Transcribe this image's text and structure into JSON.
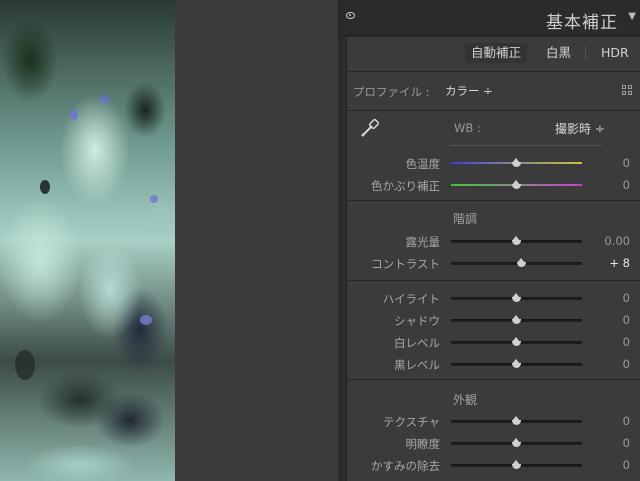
{
  "panel": {
    "title": "基本補正",
    "treatment_buttons": {
      "auto": "自動補正",
      "bw": "白黒",
      "hdr": "HDR"
    },
    "profile": {
      "label": "プロファイル :",
      "value": "カラー ÷"
    },
    "wb": {
      "label": "WB :",
      "value": "撮影時 ÷"
    },
    "sliders_wb": [
      {
        "label": "色温度",
        "value": "0",
        "position": 0.5
      },
      {
        "label": "色かぶり補正",
        "value": "0",
        "position": 0.5
      }
    ],
    "tone": {
      "title": "階調",
      "sliders": [
        {
          "label": "露光量",
          "value": "0.00",
          "position": 0.5
        },
        {
          "label": "コントラスト",
          "value": "+ 8",
          "position": 0.54
        }
      ]
    },
    "tone2": {
      "sliders": [
        {
          "label": "ハイライト",
          "value": "0",
          "position": 0.5
        },
        {
          "label": "シャドウ",
          "value": "0",
          "position": 0.5
        },
        {
          "label": "白レベル",
          "value": "0",
          "position": 0.5
        },
        {
          "label": "黒レベル",
          "value": "0",
          "position": 0.5
        }
      ]
    },
    "presence": {
      "title": "外観",
      "sliders": [
        {
          "label": "テクスチャ",
          "value": "0",
          "position": 0.5
        },
        {
          "label": "明瞭度",
          "value": "0",
          "position": 0.5
        },
        {
          "label": "かすみの除去",
          "value": "0",
          "position": 0.5
        }
      ]
    }
  },
  "icons": {
    "visibility": "eye-icon",
    "collapse": "triangle-down-icon",
    "profile_browser": "grid-icon",
    "wb_picker": "eyedropper-icon"
  },
  "colors": {
    "panel_bg": "#3b3b3b",
    "header_bg": "#2b2b2b",
    "temp_gradient": [
      "#3b3fd0",
      "#c8c23a"
    ],
    "tint_gradient": [
      "#3fc63f",
      "#c63fc6"
    ]
  }
}
